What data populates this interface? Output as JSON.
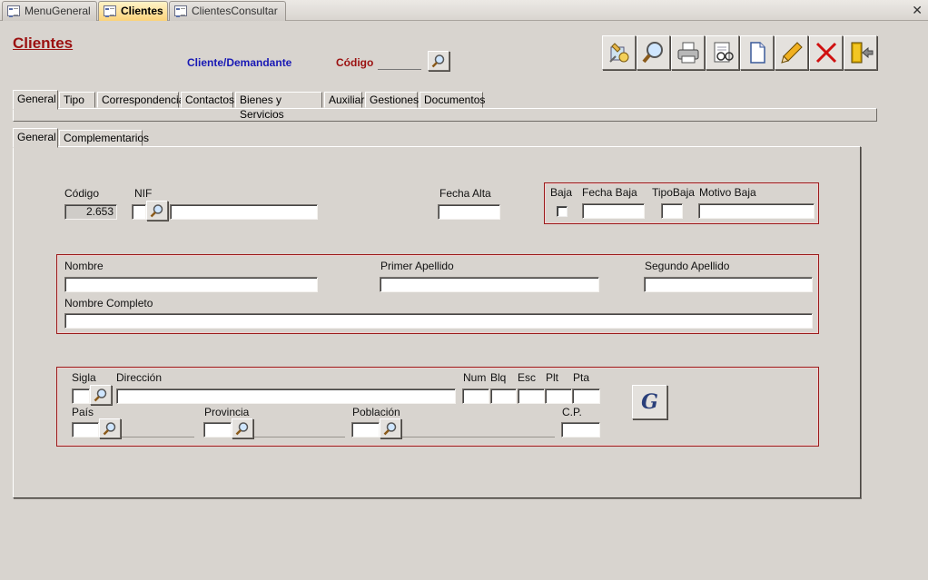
{
  "doc_tabs": [
    {
      "label": "MenuGeneral",
      "active": false
    },
    {
      "label": "Clientes",
      "active": true
    },
    {
      "label": "ClientesConsultar",
      "active": false
    }
  ],
  "header": {
    "form_title": "Clientes",
    "subtitle": "Cliente/Demandante",
    "codigo_label": "Código"
  },
  "toolbar": [
    {
      "name": "toolbar-tools-button",
      "icon": "tools-icon"
    },
    {
      "name": "toolbar-search-button",
      "icon": "magnifier-icon"
    },
    {
      "name": "toolbar-print-button",
      "icon": "printer-icon"
    },
    {
      "name": "toolbar-preview-button",
      "icon": "print-preview-icon"
    },
    {
      "name": "toolbar-new-button",
      "icon": "new-document-icon"
    },
    {
      "name": "toolbar-edit-button",
      "icon": "pencil-icon"
    },
    {
      "name": "toolbar-delete-button",
      "icon": "red-x-icon"
    },
    {
      "name": "toolbar-exit-button",
      "icon": "exit-door-icon"
    }
  ],
  "main_tabs": [
    "General",
    "Tipo",
    "Correspondencia",
    "Contactos",
    "Bienes y Servicios",
    "Auxiliar",
    "Gestiones",
    "Documentos"
  ],
  "sub_tabs": [
    "General",
    "Complementarios"
  ],
  "ident": {
    "codigo_label": "Código",
    "codigo_value": "2.653",
    "nif_label": "NIF",
    "fecha_alta_label": "Fecha Alta"
  },
  "baja": {
    "baja_label": "Baja",
    "fecha_baja_label": "Fecha Baja",
    "tipo_baja_label": "TipoBaja",
    "motivo_baja_label": "Motivo Baja"
  },
  "names": {
    "nombre_label": "Nombre",
    "primer_apellido_label": "Primer Apellido",
    "segundo_apellido_label": "Segundo Apellido",
    "nombre_completo_label": "Nombre Completo"
  },
  "address": {
    "sigla_label": "Sigla",
    "direccion_label": "Dirección",
    "num_label": "Num",
    "blq_label": "Blq",
    "esc_label": "Esc",
    "plt_label": "Plt",
    "pta_label": "Pta",
    "pais_label": "País",
    "provincia_label": "Provincia",
    "poblacion_label": "Población",
    "cp_label": "C.P.",
    "geo_button_label": "G"
  },
  "colors": {
    "title_red": "#9b1010",
    "subtitle_blue": "#1919b5",
    "group_border": "#9b1b1b",
    "active_tab": "#fad27a"
  }
}
